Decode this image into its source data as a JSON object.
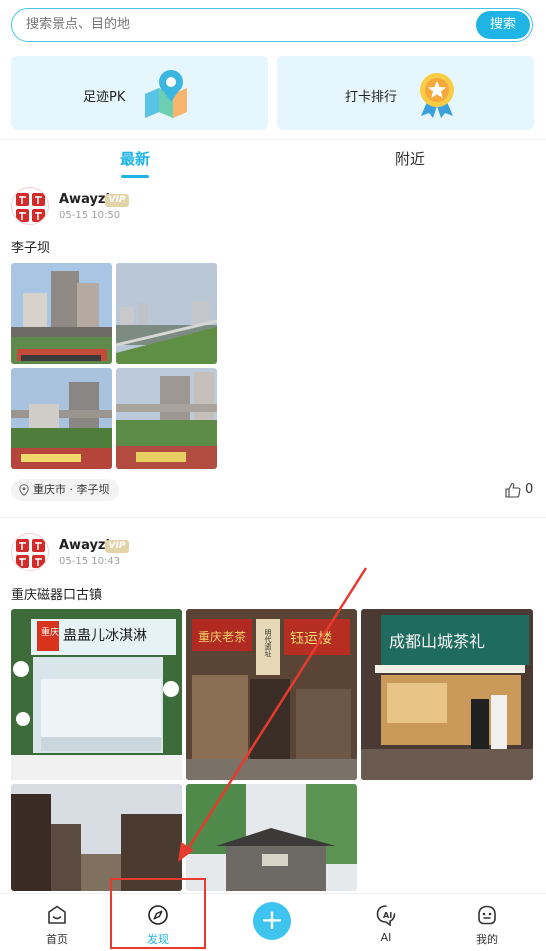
{
  "search": {
    "placeholder": "搜索景点、目的地",
    "button_label": "搜索"
  },
  "features": [
    {
      "label": "足迹PK",
      "icon": "map-pin-icon"
    },
    {
      "label": "打卡排行",
      "icon": "medal-icon"
    }
  ],
  "tabs": [
    {
      "label": "最新",
      "active": true
    },
    {
      "label": "附近",
      "active": false
    }
  ],
  "posts": [
    {
      "username": "Awayzi",
      "badge": "VIP",
      "time": "05-15 10:50",
      "text": "李子坝",
      "location": "重庆市 · 李子坝",
      "likes": "0"
    },
    {
      "username": "Awayzi",
      "badge": "VIP",
      "time": "05-15 10:43",
      "text": "重庆磁器口古镇",
      "photo_signs": [
        "重庆",
        "蛊蛊儿冰淇淋",
        "重庆老茶",
        "明代遗址",
        "钰运楼",
        "成都山城茶礼"
      ]
    }
  ],
  "nav": [
    {
      "label": "首页",
      "icon": "home-icon",
      "active": false
    },
    {
      "label": "发现",
      "icon": "compass-icon",
      "active": true
    },
    {
      "label": "",
      "icon": "plus-icon",
      "active": false
    },
    {
      "label": "AI",
      "icon": "ai-icon",
      "active": false
    },
    {
      "label": "我的",
      "icon": "profile-icon",
      "active": false
    }
  ],
  "add_symbol": "+",
  "colors": {
    "accent": "#1fb4e6",
    "card_bg": "#e6f6fd",
    "annotation": "#e63b2e"
  }
}
